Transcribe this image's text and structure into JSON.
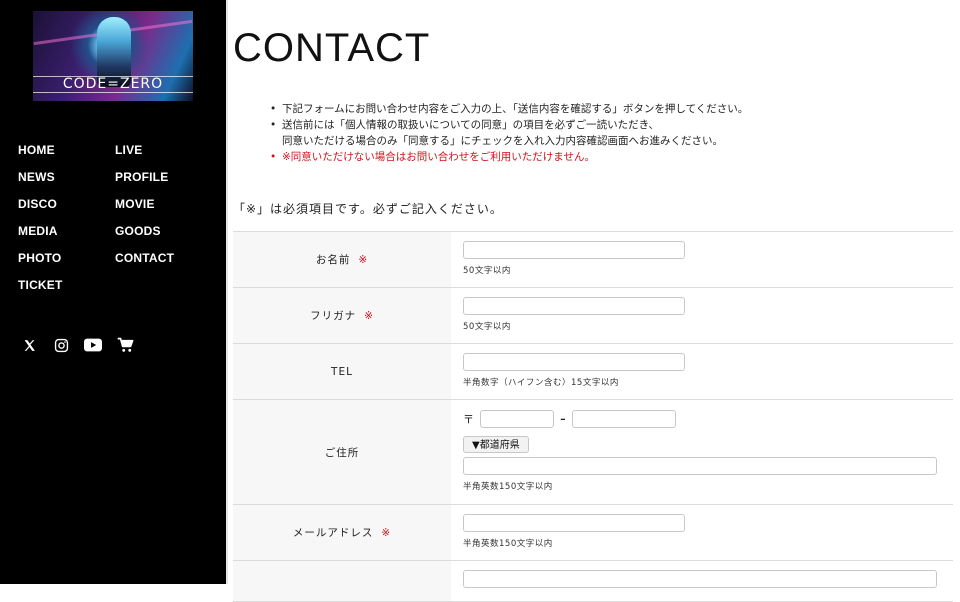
{
  "brand": {
    "logo_text": "CODE=ZERO"
  },
  "nav": {
    "col1": [
      "HOME",
      "NEWS",
      "DISCO",
      "MEDIA",
      "PHOTO",
      "TICKET"
    ],
    "col2": [
      "LIVE",
      "PROFILE",
      "MOVIE",
      "GOODS",
      "CONTACT"
    ]
  },
  "social": [
    "x-icon",
    "instagram-icon",
    "youtube-icon",
    "cart-icon"
  ],
  "page": {
    "title": "CONTACT",
    "notes": [
      "下記フォームにお問い合わせ内容をご入力の上、「送信内容を確認する」ボタンを押してください。",
      "送信前には「個人情報の取扱いについての同意」の項目を必ずご一読いただき、",
      "同意いただける場合のみ「同意する」にチェックを入れ入力内容確認画面へお進みください。",
      "※同意いただけない場合はお問い合わせをご利用いただけません。"
    ],
    "required_note": "「※」は必須項目です。必ずご記入ください。"
  },
  "form": {
    "required_mark": "※",
    "name": {
      "label": "お名前",
      "hint": "50文字以内"
    },
    "kana": {
      "label": "フリガナ",
      "hint": "50文字以内"
    },
    "tel": {
      "label": "TEL",
      "hint": "半角数字（ハイフン含む）15文字以内"
    },
    "address": {
      "label": "ご住所",
      "zip_mark": "〒",
      "zip_sep": "-",
      "pref_button": "▼都道府県",
      "hint": "半角英数150文字以内"
    },
    "email": {
      "label": "メールアドレス",
      "hint": "半角英数150文字以内"
    }
  },
  "colors": {
    "sidebar": "#000000",
    "required": "#d0111b",
    "label_bg": "#f7f7f7"
  }
}
